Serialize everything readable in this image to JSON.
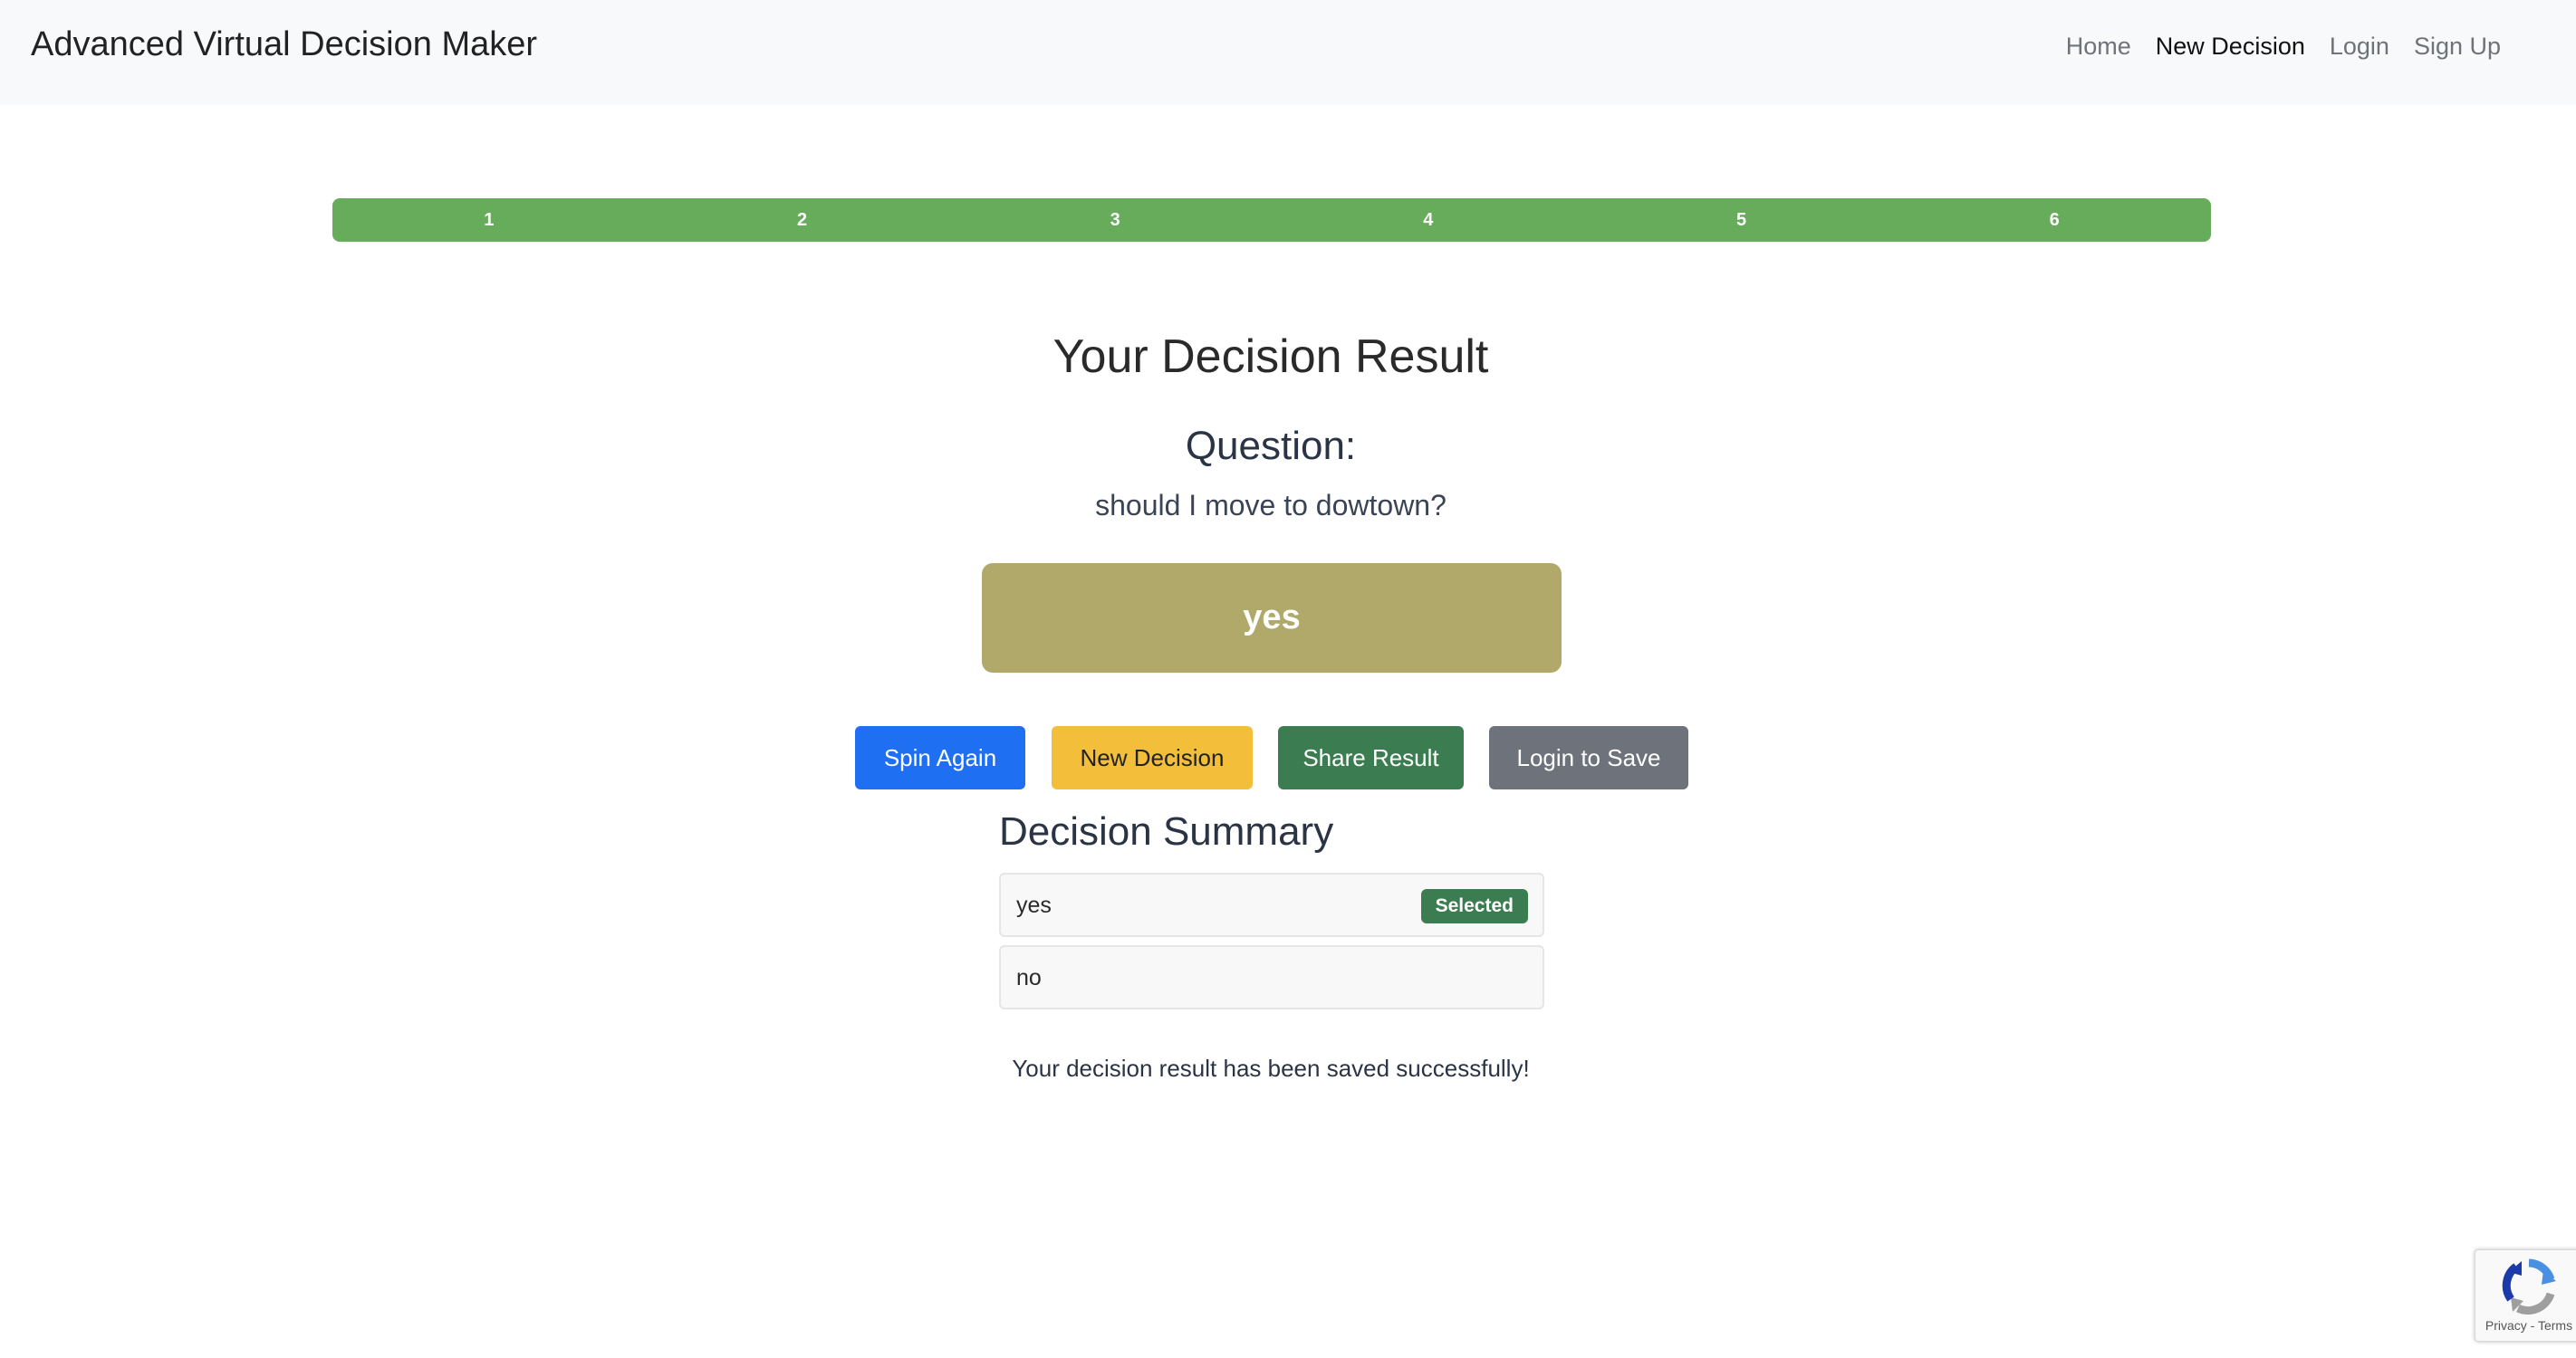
{
  "navbar": {
    "brand": "Advanced Virtual Decision Maker",
    "links": [
      "Home",
      "New Decision",
      "Login",
      "Sign Up"
    ],
    "active": "New Decision"
  },
  "steps": [
    "1",
    "2",
    "3",
    "4",
    "5",
    "6"
  ],
  "main": {
    "title": "Your Decision Result",
    "question_label": "Question:",
    "question": "should I move to dowtown?",
    "result": "yes",
    "buttons": {
      "spin_again": "Spin Again",
      "new_decision": "New Decision",
      "share_result": "Share Result",
      "login_to_save": "Login to Save"
    }
  },
  "summary": {
    "title": "Decision Summary",
    "options": [
      {
        "label": "yes",
        "selected": true
      },
      {
        "label": "no",
        "selected": false
      }
    ],
    "badge": "Selected"
  },
  "saved_message": "Your decision result has been saved successfully!",
  "recaptcha": {
    "links": "Privacy - Terms",
    "icon": "recaptcha-icon"
  },
  "colors": {
    "step_bar": "#66ac5b",
    "result_box": "#b0a96a",
    "spin_again": "#1f6ff2",
    "new_decision": "#f3bf3b",
    "share_result": "#3b7d50",
    "login_to_save": "#6e737b",
    "selected_badge": "#3b7d50"
  }
}
